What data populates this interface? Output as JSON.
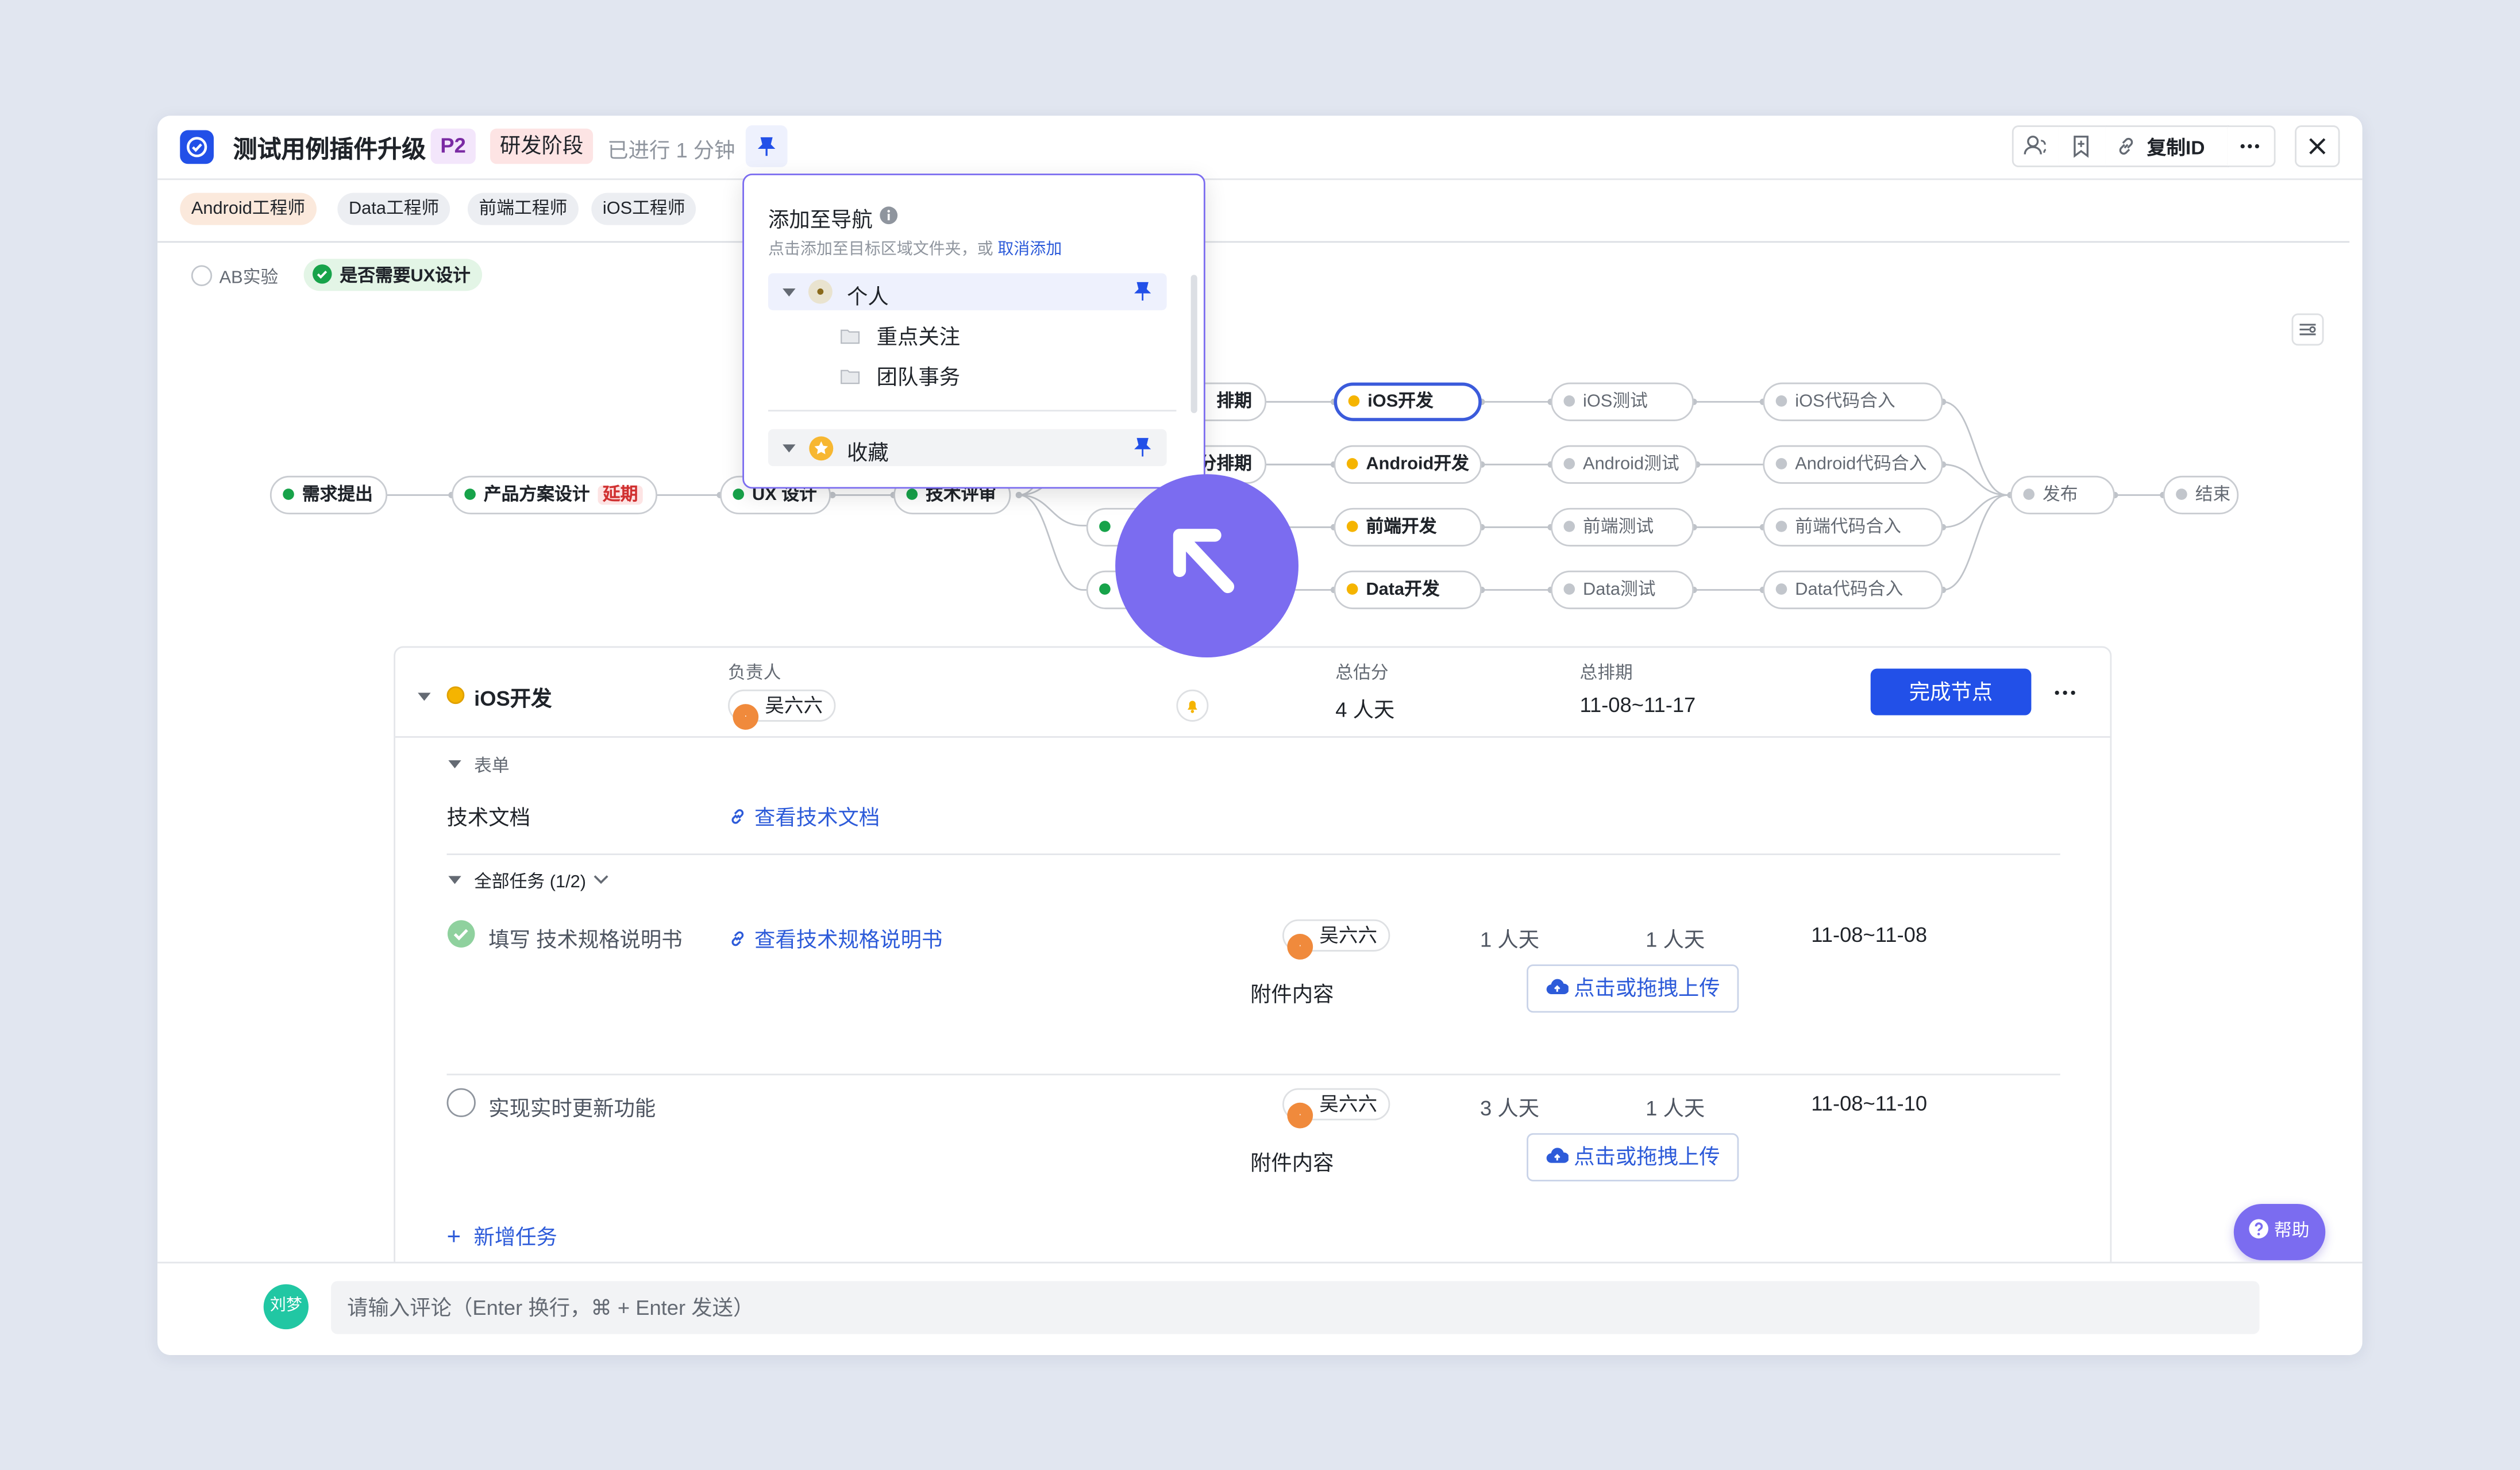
{
  "colors": {
    "accent": "#2250e8",
    "purple": "#7b6cf0",
    "done": "#17a34a",
    "doing": "#f5b400",
    "todo": "#c2c6cc"
  },
  "header": {
    "title": "测试用例插件升级",
    "priority": "P2",
    "stage": "研发阶段",
    "elapsed": "已进行 1 分钟",
    "copy_id": "复制ID"
  },
  "roles": [
    "Android工程师",
    "Data工程师",
    "前端工程师",
    "iOS工程师"
  ],
  "options": {
    "ab_test": "AB实验",
    "ux_design": "是否需要UX设计"
  },
  "nav_popup": {
    "title": "添加至导航",
    "hint": "点击添加至目标区域文件夹，或",
    "cancel": "取消添加",
    "personal": "个人",
    "folder1": "重点关注",
    "folder2": "团队事务",
    "favorites": "收藏"
  },
  "workflow": {
    "n_req": "需求提出",
    "n_prod": "产品方案设计",
    "n_prod_tag": "延期",
    "n_ux": "UX 设计",
    "n_tech": "技术评审",
    "n_sched": "排期",
    "n_sched2": "分排期",
    "n_ios_dev": "iOS开发",
    "n_and_dev": "Android开发",
    "n_fe_dev": "前端开发",
    "n_data_dev": "Data开发",
    "n_ios_test": "iOS测试",
    "n_and_test": "Android测试",
    "n_fe_test": "前端测试",
    "n_data_test": "Data测试",
    "n_ios_merge": "iOS代码合入",
    "n_and_merge": "Android代码合入",
    "n_fe_merge": "前端代码合入",
    "n_data_merge": "Data代码合入",
    "n_release": "发布",
    "n_end": "结束"
  },
  "detail": {
    "node_name": "iOS开发",
    "owner_label": "负责人",
    "owner": "吴六六",
    "estimate_label": "总估分",
    "estimate": "4 人天",
    "schedule_label": "总排期",
    "schedule": "11-08~11-17",
    "complete_button": "完成节点",
    "form_label": "表单",
    "tech_doc_label": "技术文档",
    "tech_doc_link": "查看技术文档",
    "tasks_label": "全部任务 (1/2)",
    "tasks": [
      {
        "name": "填写 技术规格说明书",
        "link": "查看技术规格说明书",
        "owner": "吴六六",
        "estimate": "1 人天",
        "actual": "1 人天",
        "dates": "11-08~11-08",
        "attach_label": "附件内容",
        "upload": "点击或拖拽上传"
      },
      {
        "name": "实现实时更新功能",
        "owner": "吴六六",
        "estimate": "3 人天",
        "actual": "1 人天",
        "dates": "11-08~11-10",
        "attach_label": "附件内容",
        "upload": "点击或拖拽上传"
      }
    ],
    "add_task": "新增任务"
  },
  "help": "帮助",
  "comment": {
    "avatar": "刘梦",
    "placeholder": "请输入评论（Enter 换行，⌘ + Enter 发送）"
  }
}
